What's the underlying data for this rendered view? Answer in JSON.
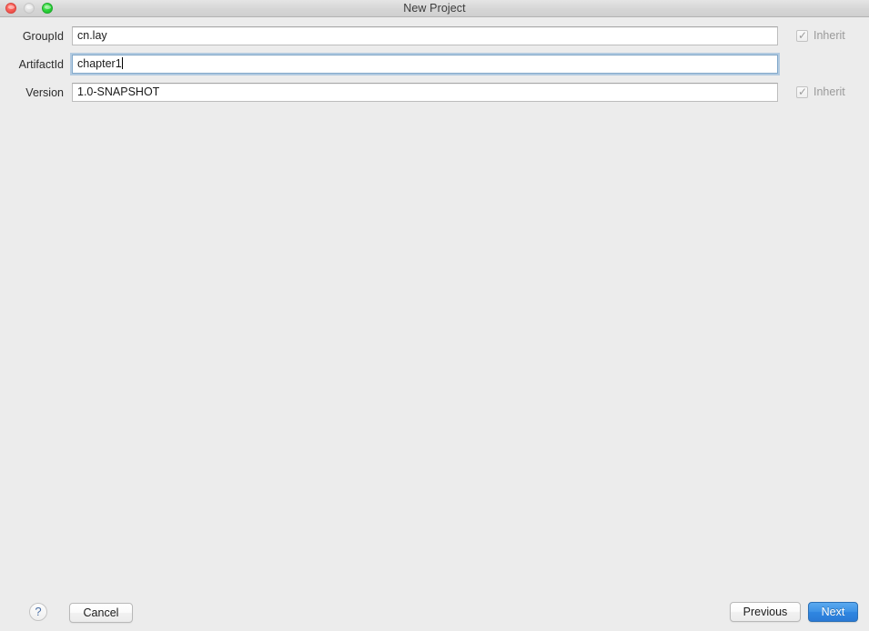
{
  "window": {
    "title": "New Project",
    "traffic_lights": [
      {
        "name": "close",
        "state": "enabled",
        "color": "#fa5e57"
      },
      {
        "name": "minimize",
        "state": "disabled",
        "color": "#e2e2e2"
      },
      {
        "name": "zoom",
        "state": "enabled",
        "color": "#2ed63c"
      }
    ]
  },
  "form": {
    "fields": [
      {
        "label": "GroupId",
        "value": "cn.lay",
        "placeholder": "",
        "focused": false,
        "inherit": {
          "label": "Inherit",
          "checked": true,
          "enabled": false
        }
      },
      {
        "label": "ArtifactId",
        "value": "chapter1",
        "placeholder": "",
        "focused": true,
        "inherit": null
      },
      {
        "label": "Version",
        "value": "1.0-SNAPSHOT",
        "placeholder": "",
        "focused": false,
        "inherit": {
          "label": "Inherit",
          "checked": true,
          "enabled": false
        }
      }
    ]
  },
  "footer": {
    "help_label": "?",
    "cancel_label": "Cancel",
    "previous_label": "Previous",
    "next_label": "Next",
    "next_accent_color": "#3e93e6"
  },
  "glyphs": {
    "checkmark": "✓"
  }
}
